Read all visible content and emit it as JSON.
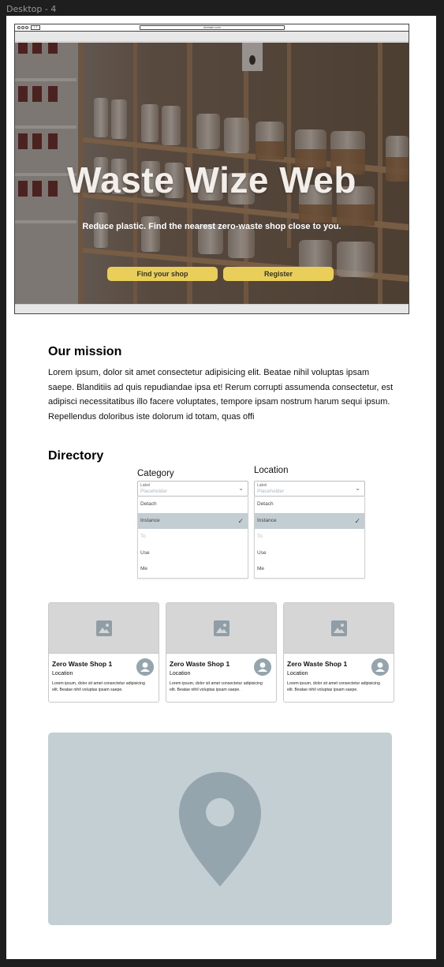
{
  "frame": {
    "title": "Desktop - 4"
  },
  "browser": {
    "address": "domain.com",
    "nav_arrows": "‹ ›"
  },
  "hero": {
    "title": "Waste Wize Web",
    "subtitle": "Reduce plastic. Find the nearest zero-waste shop close to you.",
    "find_button": "Find your shop",
    "register_button": "Register"
  },
  "mission": {
    "title": "Our mission",
    "text": "Lorem ipsum, dolor sit amet consectetur adipisicing elit. Beatae nihil voluptas ipsam saepe. Blanditiis ad quis repudiandae ipsa et! Rerum corrupti assumenda consectetur, est adipisci necessitatibus illo facere voluptates, tempore ipsam nostrum harum sequi ipsum. Repellendus doloribus iste dolorum id totam, quas offi"
  },
  "directory": {
    "title": "Directory",
    "dropdowns": [
      {
        "heading": "Category",
        "label": "Label",
        "placeholder": "Placeholder",
        "options": [
          "Detach",
          "Instance",
          "To",
          "Use",
          "Me"
        ]
      },
      {
        "heading": "Location",
        "label": "Label",
        "placeholder": "Placeholder",
        "options": [
          "Detach",
          "Instance",
          "To",
          "Use",
          "Me"
        ]
      }
    ]
  },
  "cards": [
    {
      "title": "Zero Waste Shop 1",
      "location": "Location",
      "description": "Lorem ipsum, dolor sit amet consectetur adipisicing elit. Beatae nihil voluptas ipsam saepe."
    },
    {
      "title": "Zero Waste Shop 1",
      "location": "Location",
      "description": "Lorem ipsum, dolor sit amet consectetur adipisicing elit. Beatae nihil voluptas ipsam saepe."
    },
    {
      "title": "Zero Waste Shop 1",
      "location": "Location",
      "description": "Lorem ipsum, dolor sit amet consectetur adipisicing elit. Beatae nihil voluptas ipsam saepe."
    }
  ],
  "colors": {
    "accent_button": "#e9cf5a",
    "selected_option": "#c3ced3",
    "map_background": "#c4cfd4",
    "map_pin": "#95a5ad"
  },
  "icons": {
    "image_placeholder": "image-icon",
    "avatar": "user-avatar-icon",
    "map_pin": "map-pin-icon",
    "check": "check-icon",
    "chevron": "chevron-down-icon"
  }
}
